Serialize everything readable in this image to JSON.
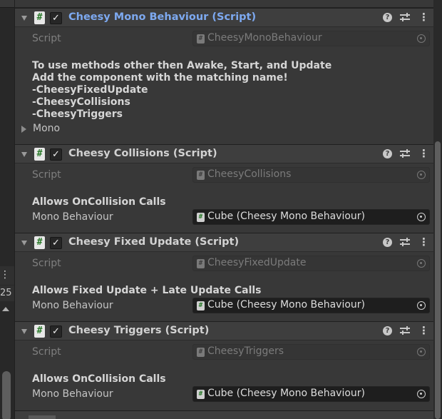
{
  "gutter": {
    "menu_glyph": "⋮",
    "number": "25"
  },
  "components": [
    {
      "title": "Cheesy Mono Behaviour (Script)",
      "enabled": true,
      "script_label": "Script",
      "script_value": "CheesyMonoBehaviour",
      "description": [
        "To use methods other then Awake, Start, and Update",
        "Add the component with the matching name!",
        "-CheesyFixedUpdate",
        "-CheesyCollisions",
        "-CheesyTriggers"
      ],
      "foldout_label": "Mono"
    },
    {
      "title": "Cheesy Collisions (Script)",
      "enabled": true,
      "script_label": "Script",
      "script_value": "CheesyCollisions",
      "description": [
        "Allows OnCollision Calls"
      ],
      "field_label": "Mono Behaviour",
      "field_value": "Cube (Cheesy Mono Behaviour)"
    },
    {
      "title": "Cheesy Fixed Update (Script)",
      "enabled": true,
      "script_label": "Script",
      "script_value": "CheesyFixedUpdate",
      "description": [
        "Allows Fixed Update + Late Update Calls"
      ],
      "field_label": "Mono Behaviour",
      "field_value": "Cube (Cheesy Mono Behaviour)"
    },
    {
      "title": "Cheesy Triggers (Script)",
      "enabled": true,
      "script_label": "Script",
      "script_value": "CheesyTriggers",
      "description": [
        "Allows OnCollision Calls"
      ],
      "field_label": "Mono Behaviour",
      "field_value": "Cube (Cheesy Mono Behaviour)"
    }
  ],
  "icons": {
    "script": "hash-icon",
    "help": "help-icon",
    "presets": "presets-icon",
    "menu": "kebab-menu-icon",
    "picker": "object-picker-icon"
  },
  "colors": {
    "selected_title": "#7da9f0",
    "background": "#383838",
    "header": "#3e3e3e"
  }
}
